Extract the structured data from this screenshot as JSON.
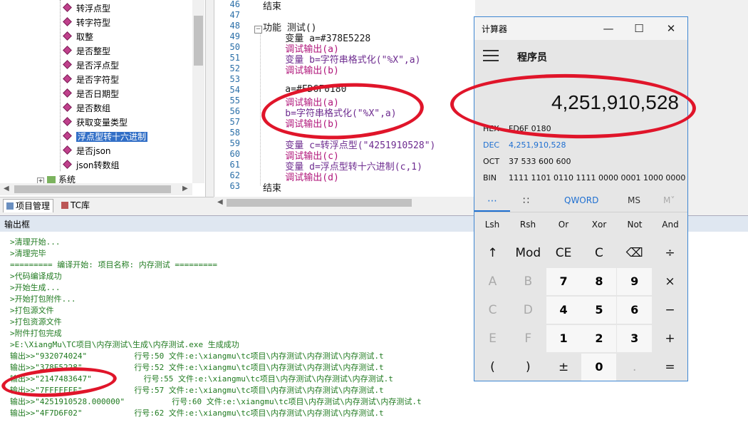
{
  "tree": {
    "items": [
      {
        "label": "转浮点型",
        "selected": false
      },
      {
        "label": "转字符型",
        "selected": false
      },
      {
        "label": "取整",
        "selected": false
      },
      {
        "label": "是否整型",
        "selected": false
      },
      {
        "label": "是否浮点型",
        "selected": false
      },
      {
        "label": "是否字符型",
        "selected": false
      },
      {
        "label": "是否日期型",
        "selected": false
      },
      {
        "label": "是否数组",
        "selected": false
      },
      {
        "label": "获取变量类型",
        "selected": false
      },
      {
        "label": "浮点型转十六进制",
        "selected": true
      },
      {
        "label": "是否json",
        "selected": false
      },
      {
        "label": "json转数组",
        "selected": false
      }
    ],
    "system_node": "系统"
  },
  "tabs": {
    "project": "项目管理",
    "tc": "TC库"
  },
  "editor": {
    "lines": [
      {
        "n": "46",
        "text": "结束"
      },
      {
        "n": "47",
        "text": ""
      },
      {
        "n": "48",
        "text": "功能 测试()"
      },
      {
        "n": "49",
        "text": "    变量 a=#378E5228"
      },
      {
        "n": "50",
        "text": "    调试输出(a)"
      },
      {
        "n": "51",
        "text": "    变量 b=字符串格式化(\"%X\",a)"
      },
      {
        "n": "52",
        "text": "    调试输出(b)"
      },
      {
        "n": "53",
        "text": ""
      },
      {
        "n": "54",
        "text": "    a=#FD6F0180"
      },
      {
        "n": "55",
        "text": "    调试输出(a)"
      },
      {
        "n": "56",
        "text": "    b=字符串格式化(\"%X\",a)"
      },
      {
        "n": "57",
        "text": "    调试输出(b)"
      },
      {
        "n": "58",
        "text": ""
      },
      {
        "n": "59",
        "text": "    变量 c=转浮点型(\"4251910528\")"
      },
      {
        "n": "60",
        "text": "    调试输出(c)"
      },
      {
        "n": "61",
        "text": "    变量 d=浮点型转十六进制(c,1)"
      },
      {
        "n": "62",
        "text": "    调试输出(d)"
      },
      {
        "n": "63",
        "text": "结束"
      }
    ]
  },
  "output": {
    "title": "输出框",
    "lines": [
      ">清理开始...",
      ">清理完毕",
      "========= 编译开始: 项目名称: 内存测试 =========",
      ">代码编译成功",
      ">开始生成...",
      ">开始打包附件...",
      ">打包源文件",
      ">打包资源文件",
      ">附件打包完成",
      ">E:\\XiangMu\\TC项目\\内存测试\\生成\\内存测试.exe 生成成功",
      "输出>>\"932074024\"          行号:50 文件:e:\\xiangmu\\tc项目\\内存测试\\内存测试\\内存测试.t",
      "输出>>\"378E5228\"           行号:52 文件:e:\\xiangmu\\tc项目\\内存测试\\内存测试\\内存测试.t",
      "输出>>\"2147483647\"           行号:55 文件:e:\\xiangmu\\tc项目\\内存测试\\内存测试\\内存测试.t",
      "输出>>\"7FFFFFFF\"           行号:57 文件:e:\\xiangmu\\tc项目\\内存测试\\内存测试\\内存测试.t",
      "输出>>\"4251910528.000000\"          行号:60 文件:e:\\xiangmu\\tc项目\\内存测试\\内存测试\\内存测试.t",
      "输出>>\"4F7D6F02\"           行号:62 文件:e:\\xiangmu\\tc项目\\内存测试\\内存测试\\内存测试.t"
    ]
  },
  "calculator": {
    "title": "计算器",
    "mode": "程序员",
    "display": "4,251,910,528",
    "radix": [
      {
        "name": "HEX",
        "value": "FD6F 0180"
      },
      {
        "name": "DEC",
        "value": "4,251,910,528"
      },
      {
        "name": "OCT",
        "value": "37 533 600 600"
      },
      {
        "name": "BIN",
        "value": "1111 1101 0110 1111 0000 0001 1000 0000"
      }
    ],
    "word_size": "QWORD",
    "memory": [
      "MS",
      "M˅"
    ],
    "bit_ops": [
      "Lsh",
      "Rsh",
      "Or",
      "Xor",
      "Not",
      "And"
    ],
    "keys": [
      [
        "↑",
        "Mod",
        "CE",
        "C",
        "⌫",
        "÷"
      ],
      [
        "A",
        "B",
        "7",
        "8",
        "9",
        "×"
      ],
      [
        "C",
        "D",
        "4",
        "5",
        "6",
        "−"
      ],
      [
        "E",
        "F",
        "1",
        "2",
        "3",
        "+"
      ],
      [
        "(",
        ")",
        "±",
        "0",
        ".",
        "="
      ]
    ],
    "accent": "#1e6fd1"
  },
  "annotation_color": "#e0152a"
}
